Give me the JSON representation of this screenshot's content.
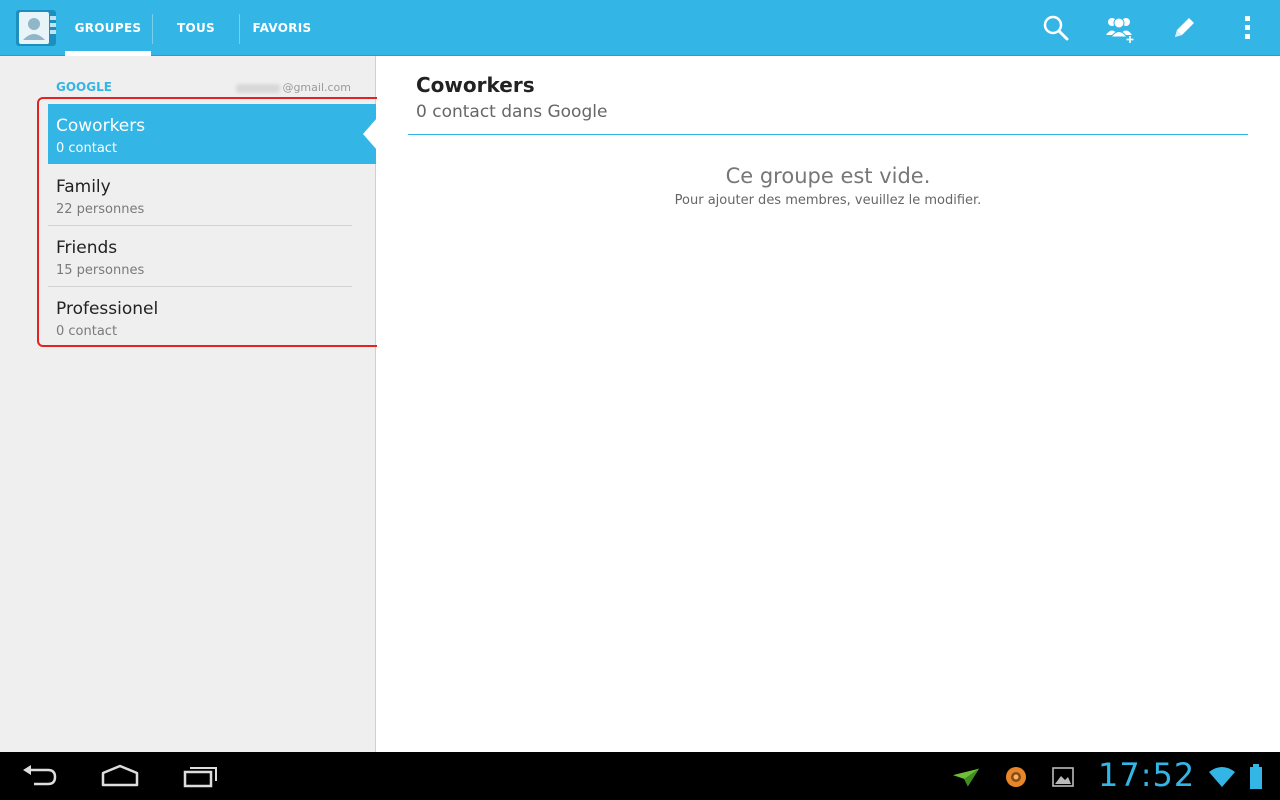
{
  "actionbar": {
    "app_icon": "contacts-app-icon",
    "tabs": [
      {
        "label": "GROUPES",
        "active": true
      },
      {
        "label": "TOUS",
        "active": false
      },
      {
        "label": "FAVORIS",
        "active": false
      }
    ],
    "actions": [
      "search-icon",
      "add-group-icon",
      "edit-icon",
      "overflow-menu-icon"
    ]
  },
  "account": {
    "type": "GOOGLE",
    "email_suffix": "@gmail.com"
  },
  "groups": [
    {
      "name": "Coworkers",
      "count": "0 contact",
      "selected": true
    },
    {
      "name": "Family",
      "count": "22 personnes",
      "selected": false
    },
    {
      "name": "Friends",
      "count": "15 personnes",
      "selected": false
    },
    {
      "name": "Professionel",
      "count": "0 contact",
      "selected": false
    }
  ],
  "detail": {
    "title": "Coworkers",
    "subtitle": "0 contact dans Google",
    "empty_title": "Ce groupe est vide.",
    "empty_hint": "Pour ajouter des membres, veuillez le modifier."
  },
  "systembar": {
    "nav": [
      "back-icon",
      "home-icon",
      "recent-apps-icon"
    ],
    "notifications": [
      "paper-plane-icon",
      "orange-circle-icon",
      "gallery-icon"
    ],
    "clock": "17:52",
    "status": [
      "wifi-icon",
      "battery-icon"
    ]
  },
  "colors": {
    "accent": "#33b5e5",
    "highlight_box": "#e32222"
  }
}
